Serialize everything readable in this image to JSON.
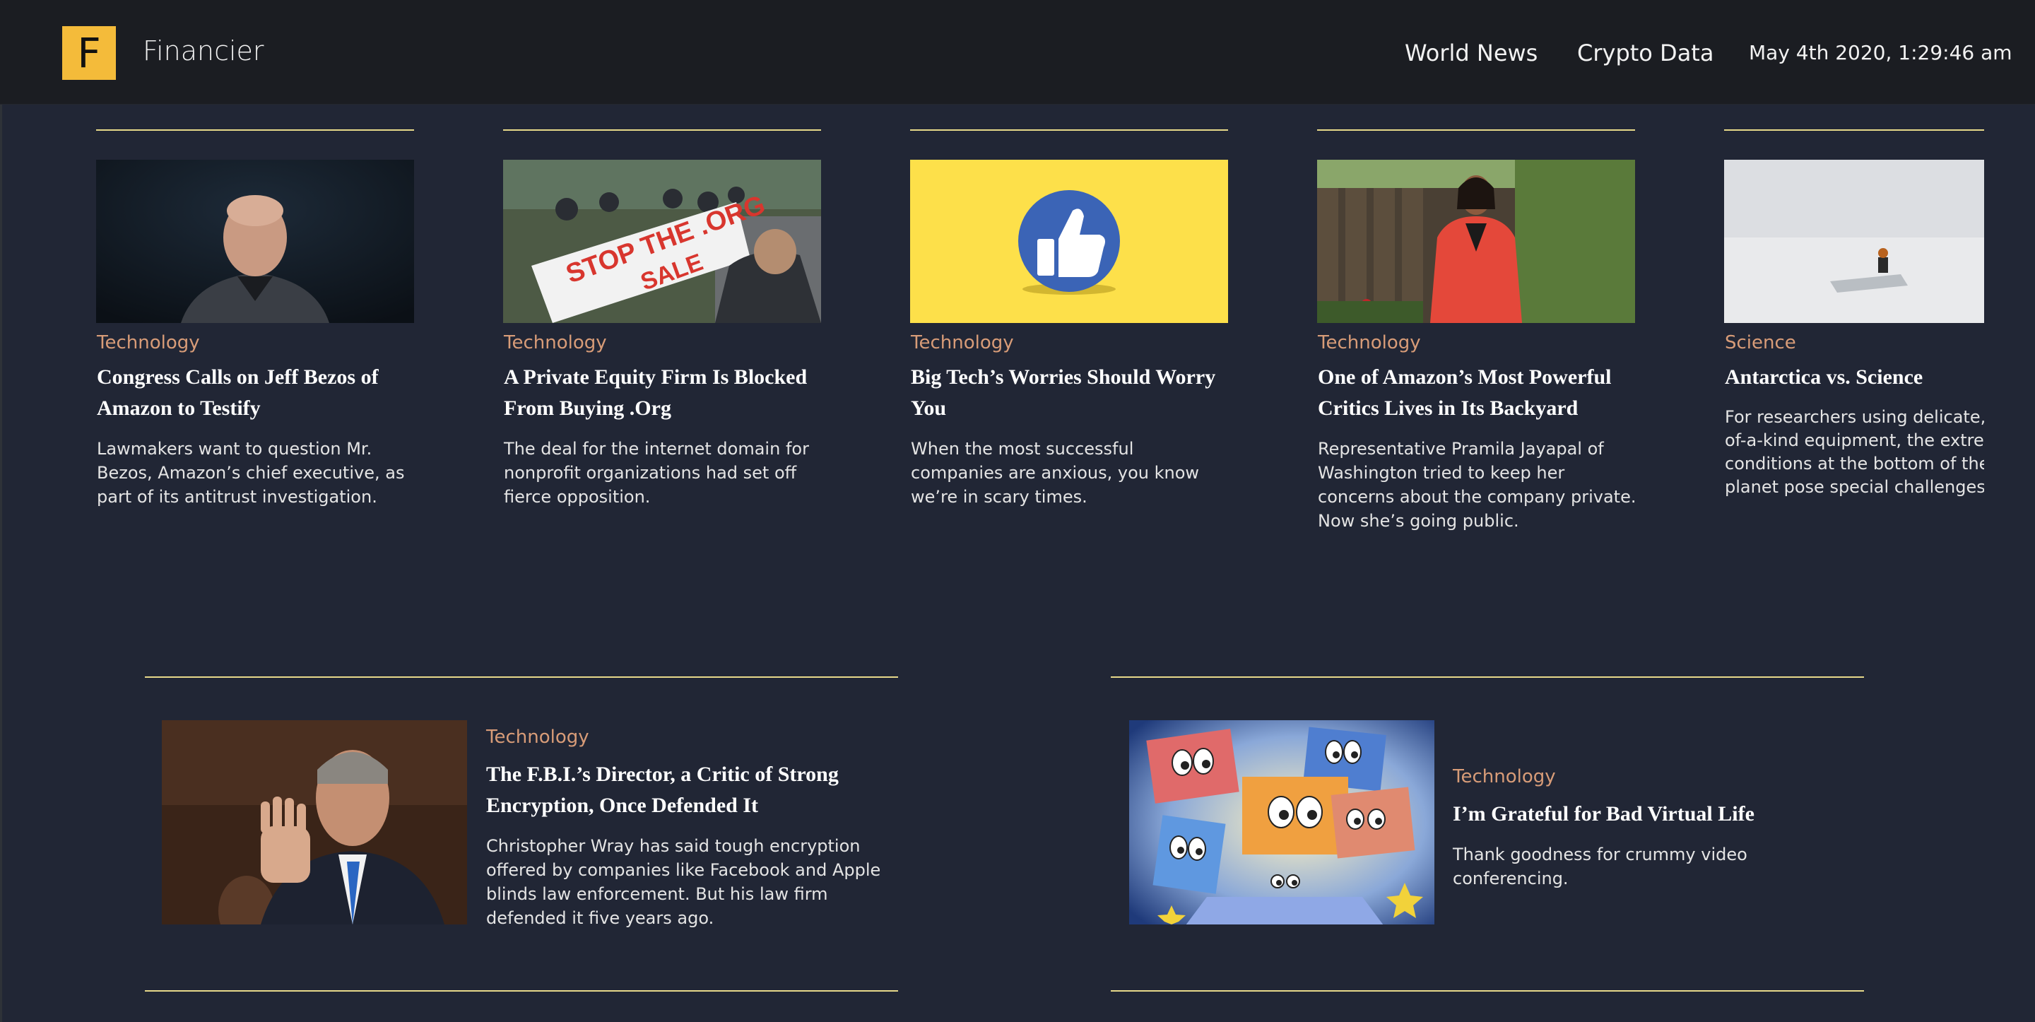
{
  "header": {
    "logo_letter": "F",
    "brand": "Financier",
    "nav": [
      "World News",
      "Crypto Data"
    ],
    "datetime": "May 4th 2020, 1:29:46 am"
  },
  "colors": {
    "background": "#212635",
    "header_bg": "#1b1d22",
    "accent_logo": "#f4bb3a",
    "rule": "#e7d98a",
    "category": "#d89c78"
  },
  "top_articles": [
    {
      "category": "Technology",
      "title_l1": "Congress Calls on Jeff Bezos of",
      "title_l2": "Amazon to Testify",
      "sum": [
        "Lawmakers want to question Mr.",
        "Bezos, Amazon’s chief executive, as",
        "part of its antitrust investigation."
      ],
      "image": "portrait-photo"
    },
    {
      "category": "Technology",
      "title_l1": "A Private Equity Firm Is Blocked",
      "title_l2": "From Buying .Org",
      "sum": [
        "The deal for the internet domain for",
        "nonprofit organizations had set off",
        "fierce opposition."
      ],
      "image": "protest-photo",
      "banner_text": [
        "STOP THE .ORG",
        "SALE"
      ]
    },
    {
      "category": "Technology",
      "title_l1": "Big Tech’s Worries Should Worry",
      "title_l2": "You",
      "sum": [
        "When the most successful",
        "companies are anxious, you know",
        "we’re in scary times."
      ],
      "image": "thumbs-up-illustration"
    },
    {
      "category": "Technology",
      "title_l1": "One of Amazon’s Most Powerful",
      "title_l2": "Critics Lives in Its Backyard",
      "sum": [
        "Representative Pramila Jayapal of",
        "Washington tried to keep her",
        "concerns about the company private.",
        "Now she’s going public."
      ],
      "image": "portrait-garden-photo"
    },
    {
      "category": "Science",
      "title_l1": "Antarctica vs. Science",
      "title_l2": "",
      "sum": [
        "For researchers using delicate, one-",
        "of-a-kind equipment, the extreme",
        "conditions at the bottom of the",
        "planet pose special challenges."
      ],
      "image": "snowfield-photo"
    }
  ],
  "bottom_articles": [
    {
      "category": "Technology",
      "title_l1": "The F.B.I.’s Director, a Critic of Strong",
      "title_l2": "Encryption, Once Defended It",
      "sum": [
        "Christopher Wray has said tough encryption",
        "offered by companies like Facebook and Apple",
        "blinds law enforcement. But his law firm",
        "defended it five years ago."
      ],
      "image": "hearing-photo"
    },
    {
      "category": "Technology",
      "title_l1": "I’m Grateful for Bad Virtual Life",
      "title_l2": "",
      "sum": [
        "Thank goodness for crummy video",
        "conferencing."
      ],
      "image": "video-screens-illustration"
    }
  ]
}
